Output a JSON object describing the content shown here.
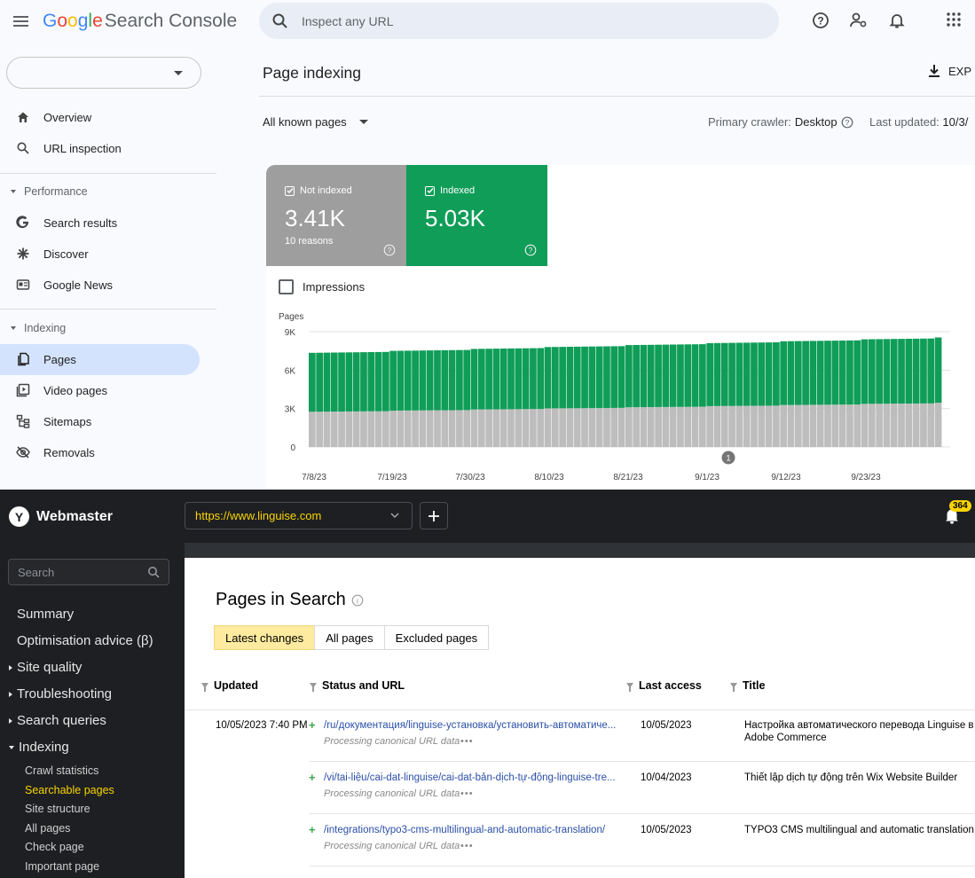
{
  "gsc": {
    "logo": {
      "word": "Google",
      "product": "Search Console"
    },
    "search": {
      "placeholder": "Inspect any URL"
    },
    "property_selector": {
      "value": ""
    },
    "nav": {
      "overview": "Overview",
      "url_inspection": "URL inspection",
      "performance_section": "Performance",
      "search_results": "Search results",
      "discover": "Discover",
      "google_news": "Google News",
      "indexing_section": "Indexing",
      "pages": "Pages",
      "video_pages": "Video pages",
      "sitemaps": "Sitemaps",
      "removals": "Removals"
    },
    "page_title": "Page indexing",
    "export_label": "EXP",
    "filter_label": "All known pages",
    "crawler_label": "Primary crawler:",
    "crawler_value": "Desktop",
    "updated_label": "Last updated:",
    "updated_value": "10/3/",
    "tiles": {
      "not_indexed": {
        "label": "Not indexed",
        "value": "3.41K",
        "sub": "10 reasons",
        "color": "#9e9e9e"
      },
      "indexed": {
        "label": "Indexed",
        "value": "5.03K",
        "color": "#0f9d58"
      }
    },
    "impressions_label": "Impressions",
    "colors": {
      "accent_blue": "#d3e3fd",
      "indexed": "#0f9d58",
      "not_indexed": "#bdbdbd"
    }
  },
  "chart_data": {
    "type": "bar",
    "stacked": true,
    "ylabel": "Pages",
    "yticks": [
      "9K",
      "6K",
      "3K",
      "0"
    ],
    "ylim": [
      0,
      9000
    ],
    "xticks": [
      "7/8/23",
      "7/19/23",
      "7/30/23",
      "8/10/23",
      "8/21/23",
      "9/1/23",
      "9/12/23",
      "9/23/23"
    ],
    "annotation": {
      "label": "1",
      "at_tick": "9/1/23"
    },
    "bar_count": 86,
    "series": [
      {
        "name": "Not indexed",
        "start": 2750,
        "end": 3450
      },
      {
        "name": "Indexed",
        "start": 4600,
        "end": 5100
      }
    ],
    "grid": true
  },
  "yandex": {
    "logo": {
      "letter": "Y",
      "name": "Webmaster"
    },
    "site_url": "https://www.linguise.com",
    "notifications": "364",
    "search": {
      "placeholder": "Search"
    },
    "nav": {
      "summary": "Summary",
      "optimisation": "Optimisation advice (β)",
      "site_quality": "Site quality",
      "troubleshooting": "Troubleshooting",
      "search_queries": "Search queries",
      "indexing": "Indexing"
    },
    "indexing_sub": [
      "Crawl statistics",
      "Searchable pages",
      "Site structure",
      "All pages",
      "Check page",
      "Important page"
    ],
    "page_title": "Pages in Search",
    "tabs": [
      "Latest changes",
      "All pages",
      "Excluded pages"
    ],
    "columns": {
      "updated": "Updated",
      "status_url": "Status and URL",
      "last_access": "Last access",
      "title": "Title"
    },
    "rows": [
      {
        "updated": "10/05/2023 7:40 PM",
        "url": "/ru/документация/linguise-установка/установить-автоматиче...",
        "status": "Processing canonical URL data",
        "last_access": "10/05/2023",
        "title": "Настройка автоматического перевода Linguise в",
        "title2": "Adobe Commerce"
      },
      {
        "updated": "",
        "url": "/vi/tai-liệu/cai-dat-linguise/cai-dat-bản-dịch-tự-động-linguise-tre...",
        "status": "Processing canonical URL data",
        "last_access": "10/04/2023",
        "title": "Thiết lập dịch tự động trên Wix Website Builder",
        "title2": ""
      },
      {
        "updated": "",
        "url": "/integrations/typo3-cms-multilingual-and-automatic-translation/",
        "status": "Processing canonical URL data",
        "last_access": "10/05/2023",
        "title": "TYPO3 CMS multilingual and automatic translation",
        "title2": ""
      }
    ],
    "colors": {
      "accent": "#fad400",
      "link": "#2a4fa8",
      "added": "#3aa54a"
    }
  }
}
